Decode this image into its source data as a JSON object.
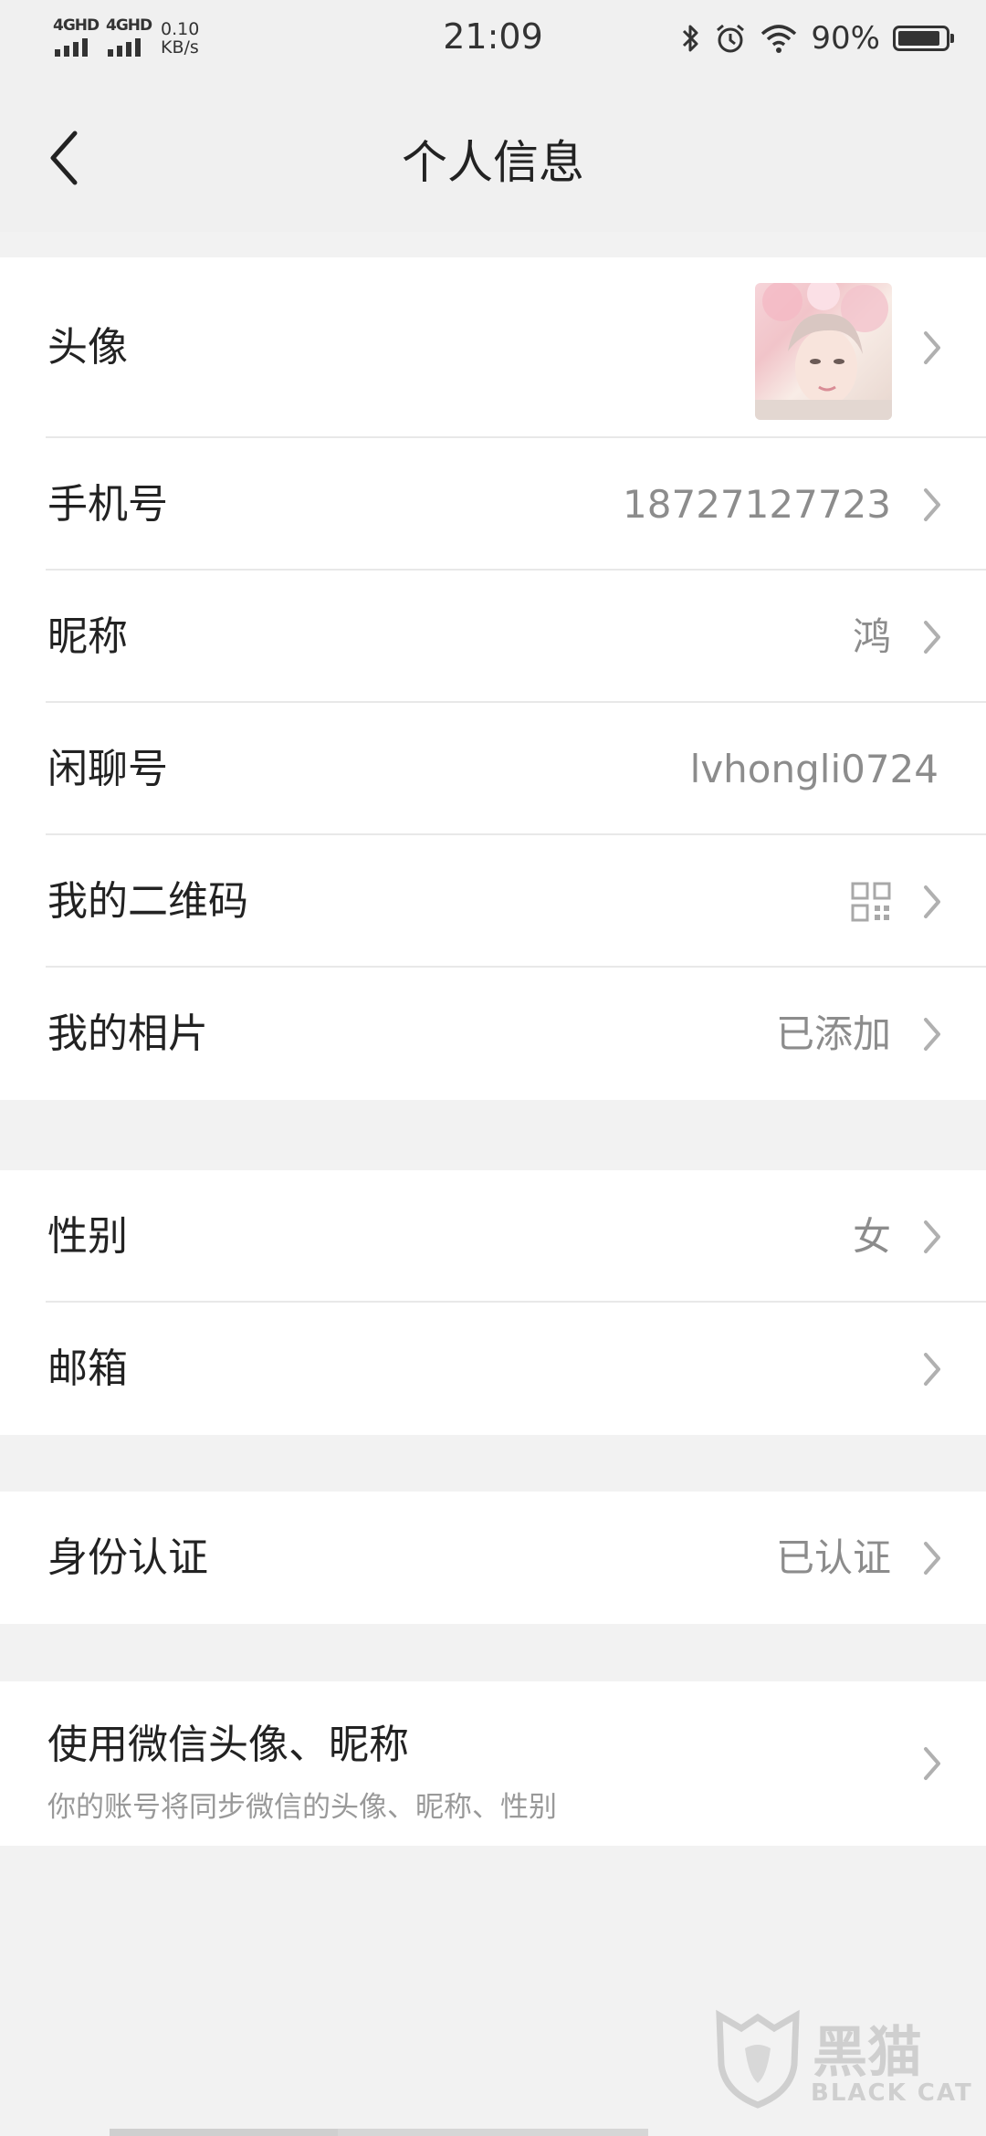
{
  "status_bar": {
    "signal_1": "4GHD",
    "signal_2": "4GHD",
    "net_speed": "0.10",
    "net_unit": "KB/s",
    "time": "21:09",
    "battery_percent": "90%",
    "battery_level": 0.9,
    "icons": [
      "bluetooth-icon",
      "alarm-icon",
      "wifi-icon",
      "battery-icon"
    ]
  },
  "header": {
    "title": "个人信息",
    "back_icon": "chevron-left-icon"
  },
  "profile": {
    "avatar_label": "头像",
    "phone_label": "手机号",
    "phone_value": "18727127723",
    "nickname_label": "昵称",
    "nickname_value": "鸿",
    "xianliao_label": "闲聊号",
    "xianliao_value": "lvhongli0724",
    "qrcode_label": "我的二维码",
    "photos_label": "我的相片",
    "photos_value": "已添加"
  },
  "details": {
    "gender_label": "性别",
    "gender_value": "女",
    "email_label": "邮箱"
  },
  "identity": {
    "label": "身份认证",
    "value": "已认证"
  },
  "wechat": {
    "label": "使用微信头像、昵称",
    "sub": "你的账号将同步微信的头像、昵称、性别"
  },
  "watermark": {
    "zh": "黑猫",
    "en": "BLACK CAT"
  },
  "colors": {
    "page_bg": "#f2f2f2",
    "card_bg": "#ffffff",
    "value_text": "#8c8c8c",
    "chevron": "#b0b0b0"
  }
}
